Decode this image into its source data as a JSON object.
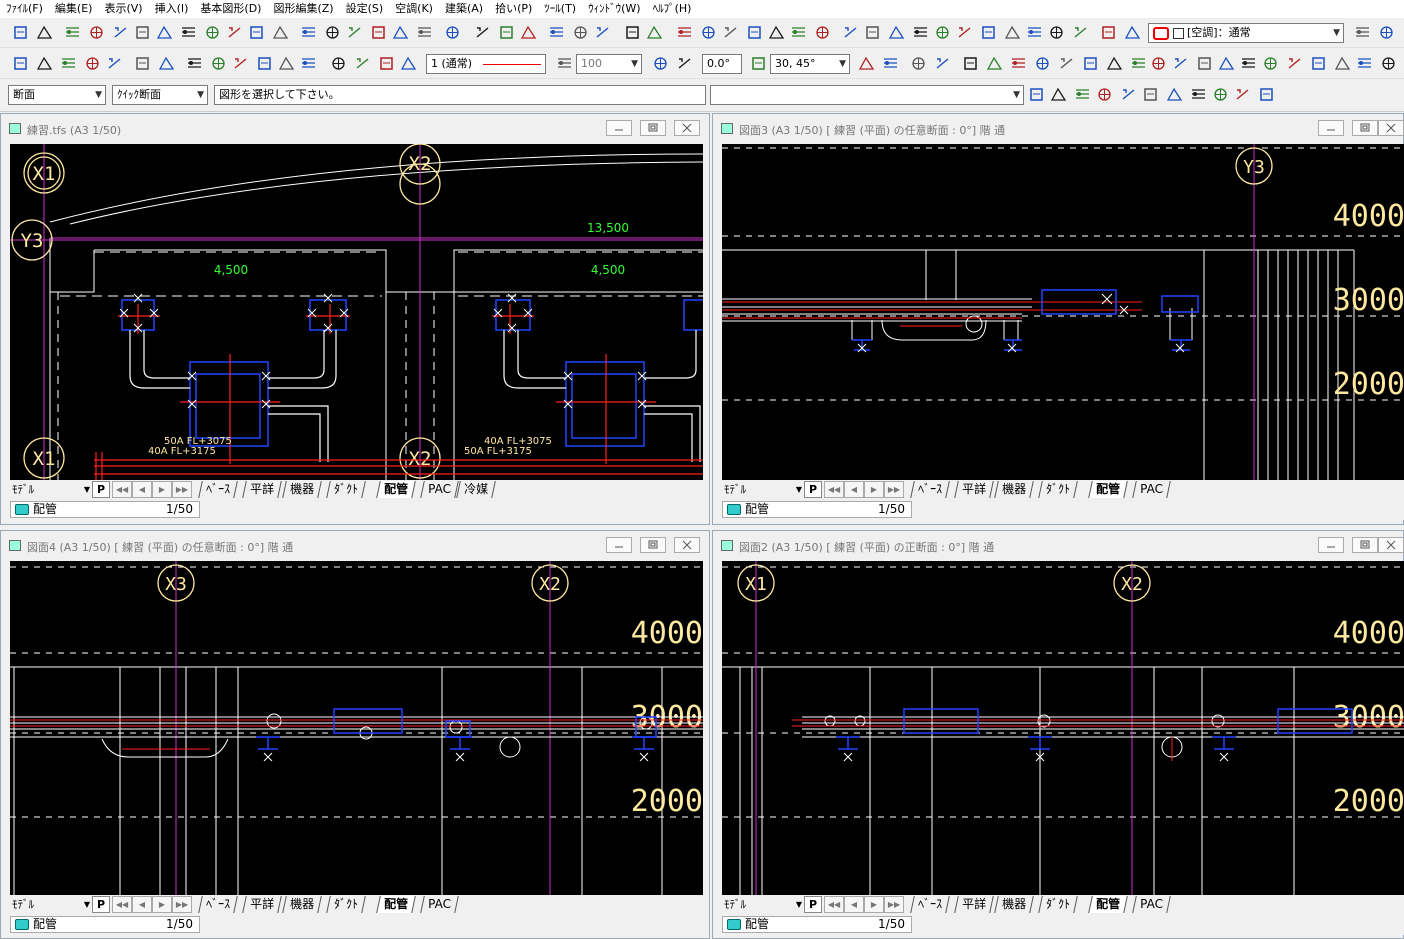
{
  "menu": [
    "ﾌｧｲﾙ(F)",
    "編集(E)",
    "表示(V)",
    "挿入(I)",
    "基本図形(D)",
    "図形編集(Z)",
    "設定(S)",
    "空調(K)",
    "建築(A)",
    "拾い(P)",
    "ﾂｰﾙ(T)",
    "ｳｨﾝﾄﾞｳ(W)",
    "ﾍﾙﾌﾟ(H)"
  ],
  "toolbar": {
    "hvac_mode": "[空調]：通常",
    "linetype": "1 (通常)",
    "lineweight": "100",
    "angle": "0.0°",
    "snap_angle": "30, 45°"
  },
  "toolbar3": {
    "view_mode": "断面",
    "section_type": "ｸｲｯｸ断面",
    "message": "図形を選択して下さい。",
    "command": ""
  },
  "colors": {
    "accent_layer": "#33cccc",
    "drawing_bg": "#000000",
    "duct_blue": "#2244ff",
    "pipe_red": "#ff2020",
    "dim_green": "#33ff33",
    "grid_magenta": "#cc44cc",
    "text_yellow": "#ffe8a0"
  },
  "windows": [
    {
      "title": "練習.tfs (A3 1/50)",
      "mode": "ﾓﾃﾞﾙ",
      "tabs": [
        "ﾍﾞｰｽ",
        "平詳",
        "機器",
        "ﾀﾞｸﾄ",
        "配管",
        "PAC",
        "冷媒"
      ],
      "active_tab": "配管",
      "layer": "配管",
      "scale": "1/50",
      "drawing": {
        "grid_labels": [
          "X1",
          "X2",
          "Y3",
          "X1",
          "X2"
        ],
        "dimensions": [
          "13,500",
          "4,500",
          "4,500"
        ],
        "pipe_notes": [
          "50A  FL+3075",
          "40A  FL+3175",
          "40A  FL+3075",
          "50A  FL+3175"
        ]
      }
    },
    {
      "title": "図面3 (A3 1/50) [ 練習 (平面) の任意断面 : 0°] 階 通",
      "mode": "ﾓﾃﾞﾙ",
      "tabs": [
        "ﾍﾞｰｽ",
        "平詳",
        "機器",
        "ﾀﾞｸﾄ",
        "配管",
        "PAC"
      ],
      "active_tab": "配管",
      "layer": "配管",
      "scale": "1/50",
      "drawing": {
        "grid_labels": [
          "Y3"
        ],
        "levels": [
          "4000",
          "3000",
          "2000"
        ]
      }
    },
    {
      "title": "図面4 (A3 1/50) [ 練習 (平面) の任意断面 : 0°] 階 通",
      "mode": "ﾓﾃﾞﾙ",
      "tabs": [
        "ﾍﾞｰｽ",
        "平詳",
        "機器",
        "ﾀﾞｸﾄ",
        "配管",
        "PAC"
      ],
      "active_tab": "配管",
      "layer": "配管",
      "scale": "1/50",
      "drawing": {
        "grid_labels": [
          "X3",
          "X2"
        ],
        "levels": [
          "4000",
          "3000",
          "2000"
        ]
      }
    },
    {
      "title": "図面2 (A3 1/50) [ 練習 (平面) の正断面 : 0°] 階 通",
      "mode": "ﾓﾃﾞﾙ",
      "tabs": [
        "ﾍﾞｰｽ",
        "平詳",
        "機器",
        "ﾀﾞｸﾄ",
        "配管",
        "PAC"
      ],
      "active_tab": "配管",
      "layer": "配管",
      "scale": "1/50",
      "drawing": {
        "grid_labels": [
          "X1",
          "X2"
        ],
        "levels": [
          "4000",
          "3000",
          "2000"
        ]
      }
    }
  ]
}
